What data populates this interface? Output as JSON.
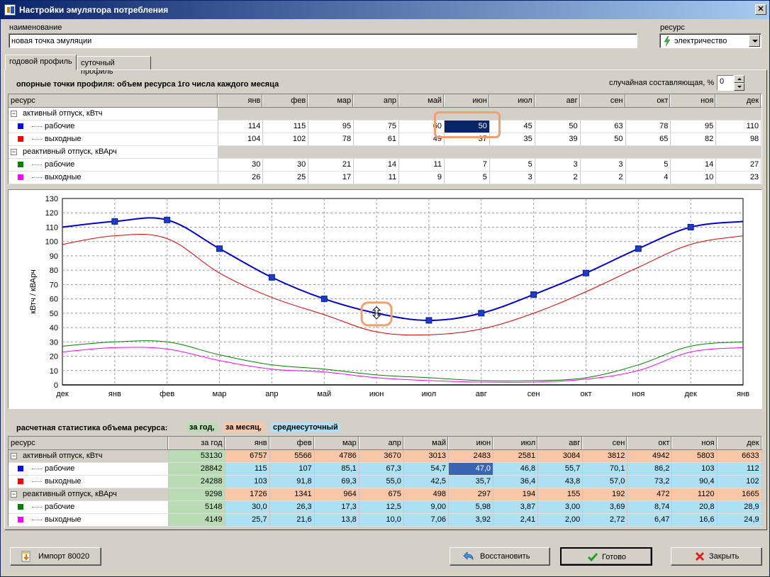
{
  "window": {
    "title": "Настройки эмулятора потребления"
  },
  "form": {
    "name_label": "наименование",
    "name_value": "новая точка эмуляции",
    "resource_label": "ресурс",
    "resource_value": "электричество"
  },
  "tabs": [
    {
      "label": "годовой профиль"
    },
    {
      "label": "суточный профиль"
    }
  ],
  "reference": {
    "title": "опорные точки профиля: объем ресурса 1го числа каждого месяца",
    "random_label": "случайная составляющая, %",
    "random_value": "0",
    "columns": [
      "ресурс",
      "янв",
      "фев",
      "мар",
      "апр",
      "май",
      "июн",
      "июл",
      "авг",
      "сен",
      "окт",
      "ноя",
      "дек"
    ],
    "groups": [
      {
        "name": "активный отпуск, кВтч",
        "rows": [
          {
            "name": "рабочие",
            "color": "#0000ff",
            "values": [
              "114",
              "115",
              "95",
              "75",
              "60",
              "50",
              "45",
              "50",
              "63",
              "78",
              "95",
              "110"
            ]
          },
          {
            "name": "выходные",
            "color": "#ff0000",
            "values": [
              "104",
              "102",
              "78",
              "61",
              "49",
              "37",
              "35",
              "39",
              "50",
              "65",
              "82",
              "98"
            ]
          }
        ]
      },
      {
        "name": "реактивный отпуск, кВАрч",
        "rows": [
          {
            "name": "рабочие",
            "color": "#008000",
            "values": [
              "30",
              "30",
              "21",
              "14",
              "11",
              "7",
              "5",
              "3",
              "3",
              "5",
              "14",
              "27"
            ]
          },
          {
            "name": "выходные",
            "color": "#ff00ff",
            "values": [
              "26",
              "25",
              "17",
              "11",
              "9",
              "5",
              "3",
              "2",
              "2",
              "4",
              "10",
              "23"
            ]
          }
        ]
      }
    ]
  },
  "chart_data": {
    "type": "line",
    "ylabel": "кВтч / кВАрч",
    "ylim": [
      0,
      130
    ],
    "yticks": [
      0,
      10,
      20,
      30,
      40,
      50,
      60,
      70,
      80,
      90,
      100,
      110,
      120,
      130
    ],
    "x": [
      "дек",
      "янв",
      "фев",
      "мар",
      "апр",
      "май",
      "июн",
      "июл",
      "авг",
      "сен",
      "окт",
      "ноя",
      "дек",
      "янв"
    ],
    "grid": true,
    "series": [
      {
        "name": "",
        "color": "#0000cc",
        "markers": true,
        "values": [
          110,
          114,
          115,
          95,
          75,
          60,
          50,
          45,
          50,
          63,
          78,
          95,
          110,
          114
        ]
      },
      {
        "name": "",
        "color": "#dd0000",
        "markers": false,
        "values": [
          98,
          104,
          102,
          78,
          61,
          49,
          37,
          35,
          39,
          50,
          65,
          82,
          98,
          104
        ]
      },
      {
        "name": "",
        "color": "#008000",
        "markers": false,
        "values": [
          27,
          30,
          30,
          21,
          14,
          11,
          7,
          5,
          3,
          3,
          5,
          14,
          27,
          30
        ]
      },
      {
        "name": "",
        "color": "#ff00ff",
        "markers": false,
        "values": [
          23,
          26,
          25,
          17,
          11,
          9,
          5,
          3,
          2,
          2,
          4,
          10,
          23,
          26
        ]
      }
    ]
  },
  "stats": {
    "title": "расчетная статистика объема ресурса:",
    "tag_year": "за год,",
    "tag_month": "за месяц,",
    "tag_daily": "среднесуточный",
    "columns": [
      "ресурс",
      "за год",
      "янв",
      "фев",
      "мар",
      "апр",
      "май",
      "июн",
      "июл",
      "авг",
      "сен",
      "окт",
      "ноя",
      "дек"
    ],
    "groups": [
      {
        "name": "активный отпуск, кВтч",
        "values": [
          "53130",
          "6757",
          "5566",
          "4786",
          "3670",
          "3013",
          "2483",
          "2581",
          "3084",
          "3812",
          "4942",
          "5803",
          "6633"
        ],
        "rows": [
          {
            "name": "рабочие",
            "color": "#0000ff",
            "values": [
              "28842",
              "115",
              "107",
              "85,1",
              "67,3",
              "54,7",
              "47,0",
              "46,8",
              "55,7",
              "70,1",
              "86,2",
              "103",
              "112"
            ]
          },
          {
            "name": "выходные",
            "color": "#ff0000",
            "values": [
              "24288",
              "103",
              "91,8",
              "69,3",
              "55,0",
              "42,5",
              "35,7",
              "36,4",
              "43,8",
              "57,0",
              "73,2",
              "90,4",
              "102"
            ]
          }
        ]
      },
      {
        "name": "реактивный отпуск, кВАрч",
        "values": [
          "9298",
          "1726",
          "1341",
          "964",
          "675",
          "498",
          "297",
          "194",
          "155",
          "192",
          "472",
          "1120",
          "1665"
        ],
        "rows": [
          {
            "name": "рабочие",
            "color": "#008000",
            "values": [
              "5148",
              "30,0",
              "26,3",
              "17,3",
              "12,5",
              "9,00",
              "5,98",
              "3,87",
              "3,00",
              "3,69",
              "8,74",
              "20,8",
              "28,9"
            ]
          },
          {
            "name": "выходные",
            "color": "#ff00ff",
            "values": [
              "4149",
              "25,7",
              "21,6",
              "13,8",
              "10,0",
              "7,06",
              "3,92",
              "2,41",
              "2,00",
              "2,72",
              "6,47",
              "16,6",
              "24,9"
            ]
          }
        ]
      }
    ]
  },
  "buttons": {
    "import": "Импорт 80020",
    "restore": "Восстановить",
    "done": "Готово",
    "close": "Закрыть"
  }
}
